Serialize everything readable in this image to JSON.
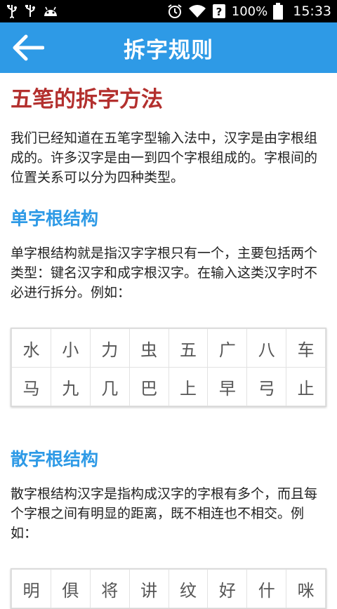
{
  "status_bar": {
    "battery": "100%",
    "time": "15:33"
  },
  "app_bar": {
    "title": "拆字规则"
  },
  "content": {
    "page_title": "五笔的拆字方法",
    "intro": "我们已经知道在五笔字型输入法中，汉字是由字根组成的。许多汉字是由一到四个字根组成的。字根间的位置关系可以分为四种类型。",
    "sections": [
      {
        "title": "单字根结构",
        "text": "单字根结构就是指汉字字根只有一个，主要包括两个类型：键名汉字和成字根汉字。在输入这类汉字时不必进行拆分。例如：",
        "rows": [
          [
            "水",
            "小",
            "力",
            "虫",
            "五",
            "广",
            "八",
            "车"
          ],
          [
            "马",
            "九",
            "几",
            "巴",
            "上",
            "早",
            "弓",
            "止"
          ]
        ]
      },
      {
        "title": "散字根结构",
        "text": "散字根结构汉字是指构成汉字的字根有多个，而且每个字根之间有明显的距离，既不相连也不相交。例如：",
        "rows": [
          [
            "明",
            "俱",
            "将",
            "讲",
            "纹",
            "好",
            "什",
            "咪"
          ]
        ]
      }
    ]
  },
  "colors": {
    "accent": "#2e9ae6",
    "title_red": "#b3302e"
  }
}
